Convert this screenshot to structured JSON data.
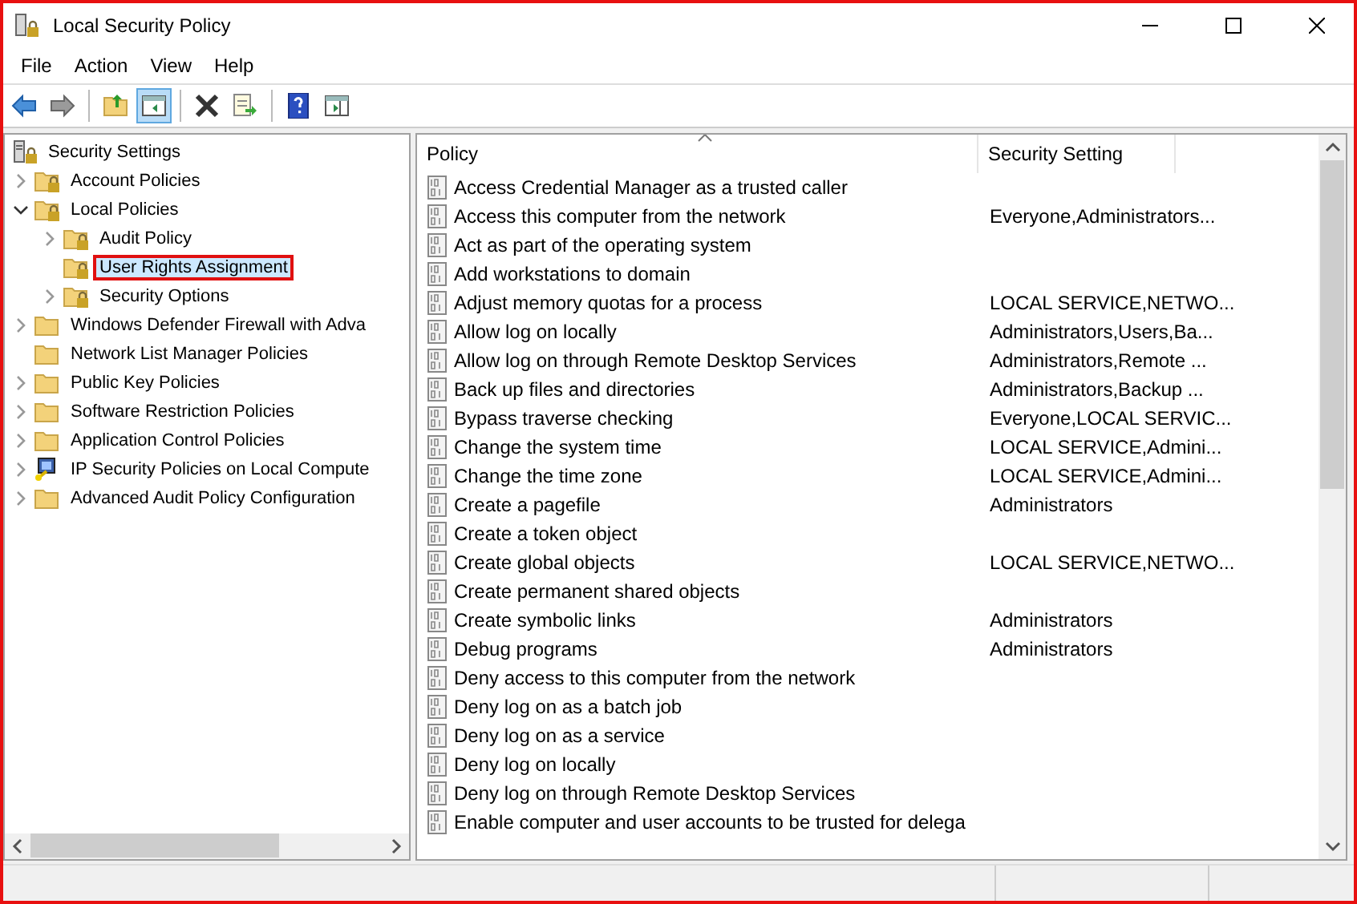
{
  "window": {
    "title": "Local Security Policy"
  },
  "menu": [
    "File",
    "Action",
    "View",
    "Help"
  ],
  "toolbar": [
    {
      "kind": "back",
      "pressed": false
    },
    {
      "kind": "forward",
      "pressed": false
    },
    {
      "kind": "separator"
    },
    {
      "kind": "up",
      "pressed": false
    },
    {
      "kind": "tree",
      "pressed": true
    },
    {
      "kind": "separator"
    },
    {
      "kind": "delete",
      "pressed": false
    },
    {
      "kind": "export",
      "pressed": false
    },
    {
      "kind": "separator"
    },
    {
      "kind": "help",
      "pressed": false
    },
    {
      "kind": "action-pane",
      "pressed": false
    }
  ],
  "tree": [
    {
      "label": "Security Settings",
      "kind": "security",
      "selected": false,
      "highlighted": false,
      "children": [
        {
          "label": "Account Policies",
          "kind": "folder-lock",
          "expandable": true,
          "expanded": false,
          "selected": false,
          "highlighted": false
        },
        {
          "label": "Local Policies",
          "kind": "folder-lock",
          "expandable": true,
          "expanded": true,
          "selected": false,
          "highlighted": false,
          "children": [
            {
              "label": "Audit Policy",
              "kind": "folder-lock",
              "expandable": true,
              "expanded": false,
              "selected": false,
              "highlighted": false
            },
            {
              "label": "User Rights Assignment",
              "kind": "folder-lock",
              "expandable": false,
              "selected": true,
              "highlighted": true
            },
            {
              "label": "Security Options",
              "kind": "folder-lock",
              "expandable": true,
              "expanded": false,
              "selected": false,
              "highlighted": false
            }
          ]
        },
        {
          "label": "Windows Defender Firewall with Adva",
          "kind": "folder",
          "expandable": true,
          "expanded": false,
          "selected": false,
          "highlighted": false
        },
        {
          "label": "Network List Manager Policies",
          "kind": "folder",
          "expandable": false,
          "selected": false,
          "highlighted": false
        },
        {
          "label": "Public Key Policies",
          "kind": "folder",
          "expandable": true,
          "expanded": false,
          "selected": false,
          "highlighted": false
        },
        {
          "label": "Software Restriction Policies",
          "kind": "folder",
          "expandable": true,
          "expanded": false,
          "selected": false,
          "highlighted": false
        },
        {
          "label": "Application Control Policies",
          "kind": "folder",
          "expandable": true,
          "expanded": false,
          "selected": false,
          "highlighted": false
        },
        {
          "label": "IP Security Policies on Local Compute",
          "kind": "ip-security",
          "expandable": true,
          "expanded": false,
          "selected": false,
          "highlighted": false
        },
        {
          "label": "Advanced Audit Policy Configuration",
          "kind": "folder",
          "expandable": true,
          "expanded": false,
          "selected": false,
          "highlighted": false
        }
      ]
    }
  ],
  "table": {
    "columns": [
      {
        "label": "Policy",
        "sorted": true
      },
      {
        "label": "Security Setting",
        "sorted": false
      }
    ],
    "rows": [
      {
        "policy": "Access Credential Manager as a trusted caller",
        "setting": ""
      },
      {
        "policy": "Access this computer from the network",
        "setting": "Everyone,Administrators..."
      },
      {
        "policy": "Act as part of the operating system",
        "setting": ""
      },
      {
        "policy": "Add workstations to domain",
        "setting": ""
      },
      {
        "policy": "Adjust memory quotas for a process",
        "setting": "LOCAL SERVICE,NETWO..."
      },
      {
        "policy": "Allow log on locally",
        "setting": "Administrators,Users,Ba..."
      },
      {
        "policy": "Allow log on through Remote Desktop Services",
        "setting": "Administrators,Remote ..."
      },
      {
        "policy": "Back up files and directories",
        "setting": "Administrators,Backup ..."
      },
      {
        "policy": "Bypass traverse checking",
        "setting": "Everyone,LOCAL SERVIC..."
      },
      {
        "policy": "Change the system time",
        "setting": "LOCAL SERVICE,Admini..."
      },
      {
        "policy": "Change the time zone",
        "setting": "LOCAL SERVICE,Admini..."
      },
      {
        "policy": "Create a pagefile",
        "setting": "Administrators"
      },
      {
        "policy": "Create a token object",
        "setting": ""
      },
      {
        "policy": "Create global objects",
        "setting": "LOCAL SERVICE,NETWO..."
      },
      {
        "policy": "Create permanent shared objects",
        "setting": ""
      },
      {
        "policy": "Create symbolic links",
        "setting": "Administrators"
      },
      {
        "policy": "Debug programs",
        "setting": "Administrators"
      },
      {
        "policy": "Deny access to this computer from the network",
        "setting": ""
      },
      {
        "policy": "Deny log on as a batch job",
        "setting": ""
      },
      {
        "policy": "Deny log on as a service",
        "setting": ""
      },
      {
        "policy": "Deny log on locally",
        "setting": ""
      },
      {
        "policy": "Deny log on through Remote Desktop Services",
        "setting": ""
      },
      {
        "policy": "Enable computer and user accounts to be trusted for delega",
        "setting": ""
      }
    ]
  }
}
